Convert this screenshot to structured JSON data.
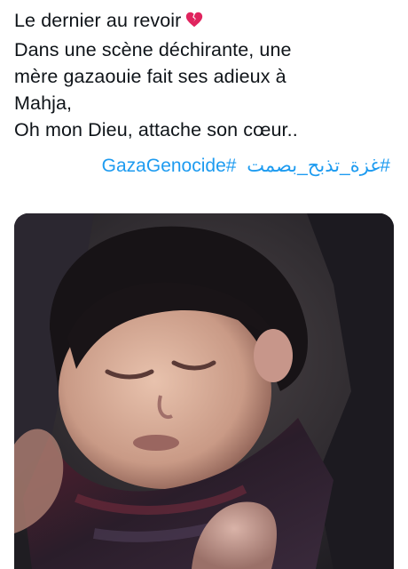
{
  "tweet": {
    "lines": [
      "Le dernier au revoir",
      "Dans une scène déchirante, une",
      "mère gazaouie fait ses adieux à",
      "Mahja,",
      "Oh mon Dieu, attache son cœur.."
    ],
    "emoji_icon": "broken-heart-icon",
    "hashtags": [
      "#غزة_تذبح_بصمت",
      "GazaGenocide#"
    ],
    "hashtag_color": "#1d9bf0"
  },
  "media": {
    "type": "video-still",
    "subject": "sleeping-child-photo"
  }
}
